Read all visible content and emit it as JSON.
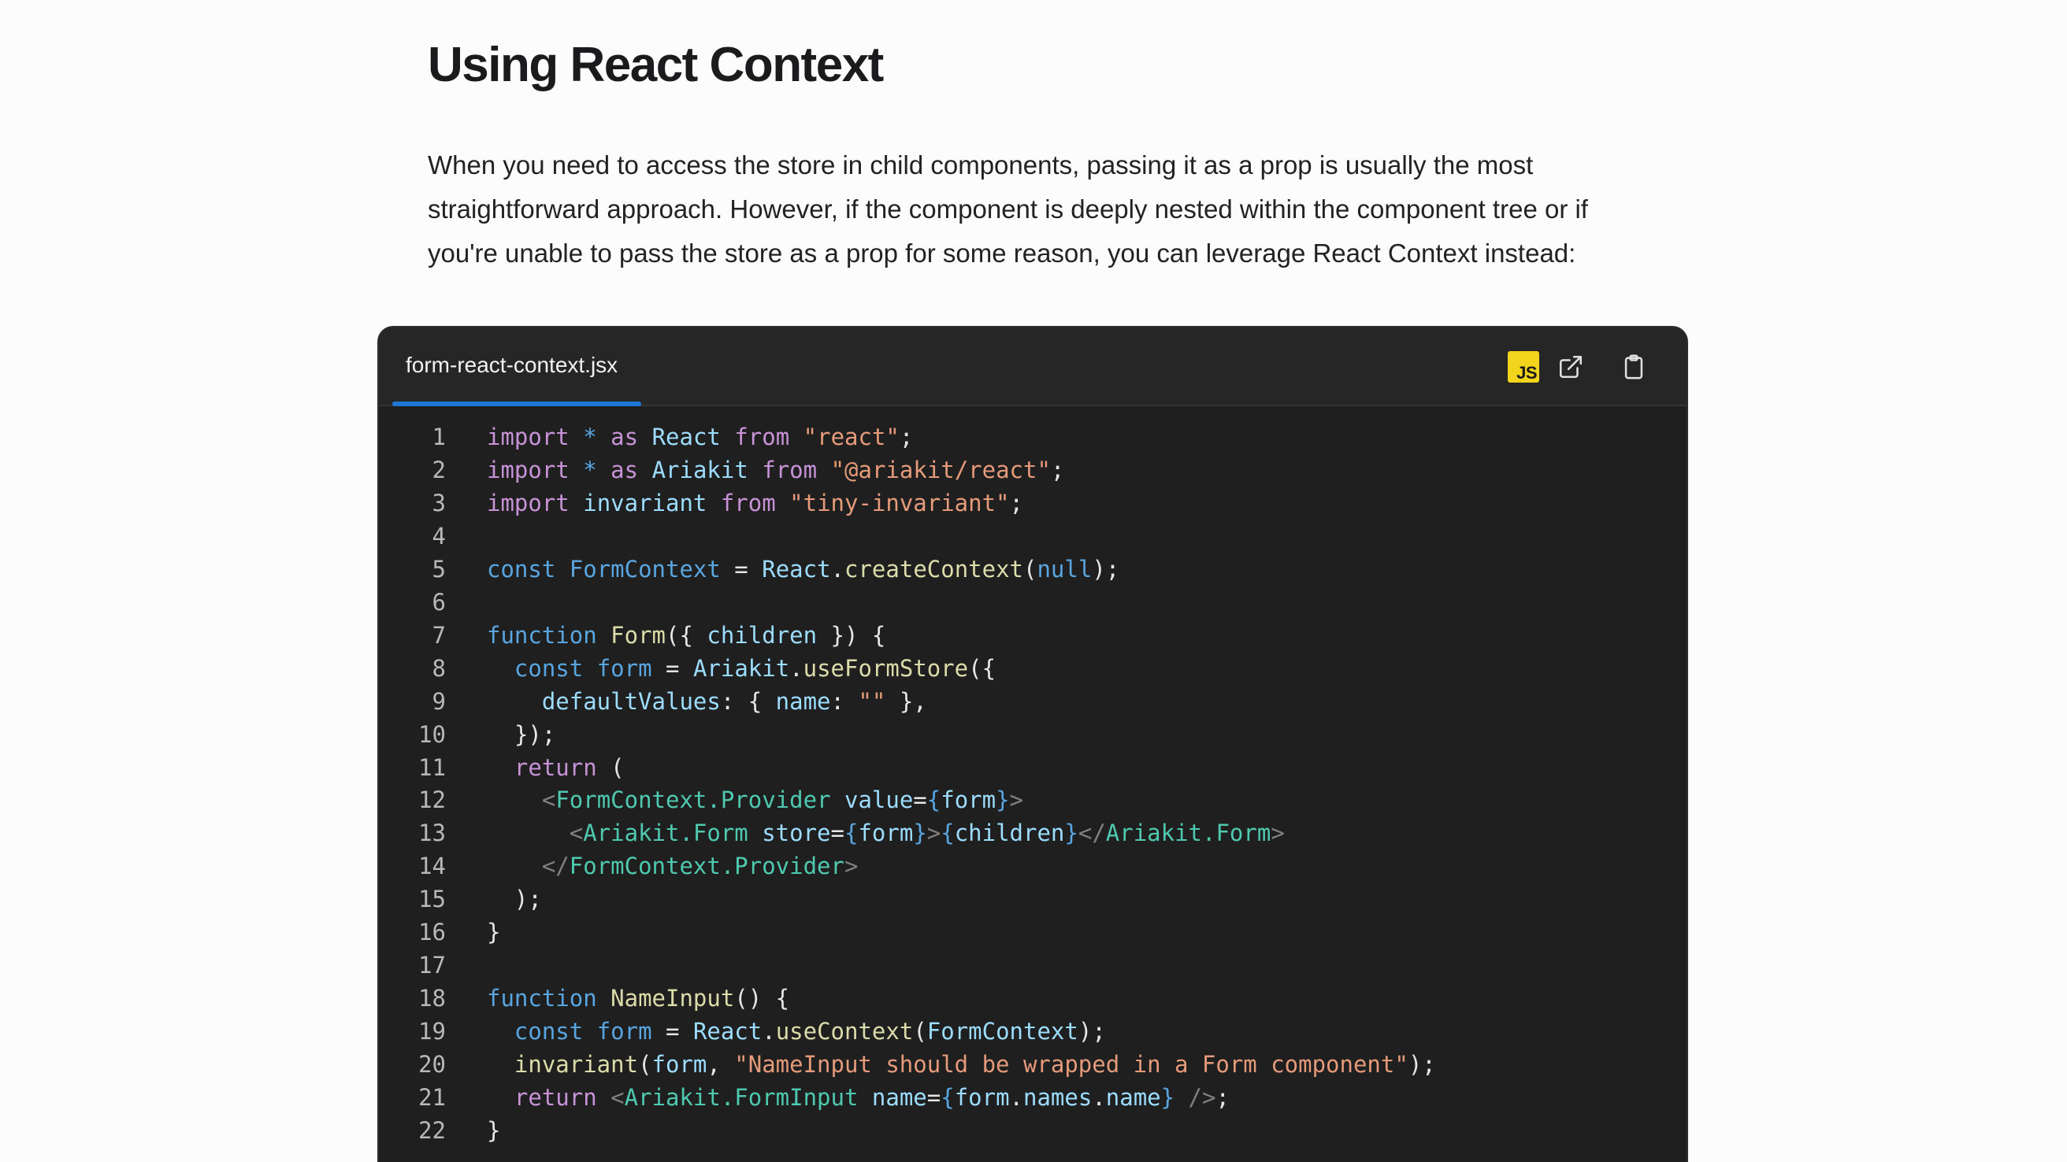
{
  "article": {
    "title": "Using React Context",
    "intro_lines": [
      "When you need to access the store in child components, passing it as a prop is usually the most",
      "straightforward approach. However, if the component is deeply nested within the component tree or if",
      "you're unable to pass the store as a prop for some reason, you can leverage React Context instead:"
    ]
  },
  "code_block": {
    "filename": "form-react-context.jsx",
    "language_badge": "JS",
    "icons": {
      "badge": "javascript-icon",
      "open": "external-link-icon",
      "copy": "clipboard-icon"
    },
    "colors": {
      "keyword": "#c792d6",
      "storage": "#58a5e0",
      "identifier": "#9cdcfe",
      "function": "#dcdcaa",
      "string": "#e59a7a",
      "tag": "#4ec9b0",
      "punct": "#808080",
      "plain": "#e6e6e6",
      "brace": "#58a5e0"
    },
    "lines": [
      {
        "n": "1",
        "tokens": [
          [
            "import",
            "keyword"
          ],
          [
            " ",
            "plain"
          ],
          [
            "*",
            "storage"
          ],
          [
            " ",
            "plain"
          ],
          [
            "as",
            "keyword"
          ],
          [
            " ",
            "plain"
          ],
          [
            "React",
            "identifier"
          ],
          [
            " ",
            "plain"
          ],
          [
            "from",
            "keyword"
          ],
          [
            " ",
            "plain"
          ],
          [
            "\"react\"",
            "string"
          ],
          [
            ";",
            "plain"
          ]
        ]
      },
      {
        "n": "2",
        "tokens": [
          [
            "import",
            "keyword"
          ],
          [
            " ",
            "plain"
          ],
          [
            "*",
            "storage"
          ],
          [
            " ",
            "plain"
          ],
          [
            "as",
            "keyword"
          ],
          [
            " ",
            "plain"
          ],
          [
            "Ariakit",
            "identifier"
          ],
          [
            " ",
            "plain"
          ],
          [
            "from",
            "keyword"
          ],
          [
            " ",
            "plain"
          ],
          [
            "\"@ariakit/react\"",
            "string"
          ],
          [
            ";",
            "plain"
          ]
        ]
      },
      {
        "n": "3",
        "tokens": [
          [
            "import",
            "keyword"
          ],
          [
            " ",
            "plain"
          ],
          [
            "invariant",
            "identifier"
          ],
          [
            " ",
            "plain"
          ],
          [
            "from",
            "keyword"
          ],
          [
            " ",
            "plain"
          ],
          [
            "\"tiny-invariant\"",
            "string"
          ],
          [
            ";",
            "plain"
          ]
        ]
      },
      {
        "n": "4",
        "tokens": []
      },
      {
        "n": "5",
        "tokens": [
          [
            "const",
            "storage"
          ],
          [
            " ",
            "plain"
          ],
          [
            "FormContext",
            "storage"
          ],
          [
            " = ",
            "plain"
          ],
          [
            "React",
            "identifier"
          ],
          [
            ".",
            "plain"
          ],
          [
            "createContext",
            "function"
          ],
          [
            "(",
            "plain"
          ],
          [
            "null",
            "storage"
          ],
          [
            ");",
            "plain"
          ]
        ]
      },
      {
        "n": "6",
        "tokens": []
      },
      {
        "n": "7",
        "tokens": [
          [
            "function",
            "storage"
          ],
          [
            " ",
            "plain"
          ],
          [
            "Form",
            "function"
          ],
          [
            "({ ",
            "plain"
          ],
          [
            "children",
            "identifier"
          ],
          [
            " }) {",
            "plain"
          ]
        ]
      },
      {
        "n": "8",
        "tokens": [
          [
            "  ",
            "plain"
          ],
          [
            "const",
            "storage"
          ],
          [
            " ",
            "plain"
          ],
          [
            "form",
            "storage"
          ],
          [
            " = ",
            "plain"
          ],
          [
            "Ariakit",
            "identifier"
          ],
          [
            ".",
            "plain"
          ],
          [
            "useFormStore",
            "function"
          ],
          [
            "({",
            "plain"
          ]
        ]
      },
      {
        "n": "9",
        "tokens": [
          [
            "    ",
            "plain"
          ],
          [
            "defaultValues",
            "identifier"
          ],
          [
            ": { ",
            "plain"
          ],
          [
            "name",
            "identifier"
          ],
          [
            ": ",
            "plain"
          ],
          [
            "\"\"",
            "string"
          ],
          [
            " },",
            "plain"
          ]
        ]
      },
      {
        "n": "10",
        "tokens": [
          [
            "  });",
            "plain"
          ]
        ]
      },
      {
        "n": "11",
        "tokens": [
          [
            "  ",
            "plain"
          ],
          [
            "return",
            "keyword"
          ],
          [
            " (",
            "plain"
          ]
        ]
      },
      {
        "n": "12",
        "tokens": [
          [
            "    ",
            "plain"
          ],
          [
            "<",
            "punct"
          ],
          [
            "FormContext.Provider",
            "tag"
          ],
          [
            " ",
            "plain"
          ],
          [
            "value",
            "identifier"
          ],
          [
            "=",
            "plain"
          ],
          [
            "{",
            "brace"
          ],
          [
            "form",
            "identifier"
          ],
          [
            "}",
            "brace"
          ],
          [
            ">",
            "punct"
          ]
        ]
      },
      {
        "n": "13",
        "tokens": [
          [
            "      ",
            "plain"
          ],
          [
            "<",
            "punct"
          ],
          [
            "Ariakit.Form",
            "tag"
          ],
          [
            " ",
            "plain"
          ],
          [
            "store",
            "identifier"
          ],
          [
            "=",
            "plain"
          ],
          [
            "{",
            "brace"
          ],
          [
            "form",
            "identifier"
          ],
          [
            "}",
            "brace"
          ],
          [
            ">",
            "punct"
          ],
          [
            "{",
            "brace"
          ],
          [
            "children",
            "identifier"
          ],
          [
            "}",
            "brace"
          ],
          [
            "</",
            "punct"
          ],
          [
            "Ariakit.Form",
            "tag"
          ],
          [
            ">",
            "punct"
          ]
        ]
      },
      {
        "n": "14",
        "tokens": [
          [
            "    ",
            "plain"
          ],
          [
            "</",
            "punct"
          ],
          [
            "FormContext.Provider",
            "tag"
          ],
          [
            ">",
            "punct"
          ]
        ]
      },
      {
        "n": "15",
        "tokens": [
          [
            "  );",
            "plain"
          ]
        ]
      },
      {
        "n": "16",
        "tokens": [
          [
            "}",
            "plain"
          ]
        ]
      },
      {
        "n": "17",
        "tokens": []
      },
      {
        "n": "18",
        "tokens": [
          [
            "function",
            "storage"
          ],
          [
            " ",
            "plain"
          ],
          [
            "NameInput",
            "function"
          ],
          [
            "() {",
            "plain"
          ]
        ]
      },
      {
        "n": "19",
        "tokens": [
          [
            "  ",
            "plain"
          ],
          [
            "const",
            "storage"
          ],
          [
            " ",
            "plain"
          ],
          [
            "form",
            "storage"
          ],
          [
            " = ",
            "plain"
          ],
          [
            "React",
            "identifier"
          ],
          [
            ".",
            "plain"
          ],
          [
            "useContext",
            "function"
          ],
          [
            "(",
            "plain"
          ],
          [
            "FormContext",
            "identifier"
          ],
          [
            ");",
            "plain"
          ]
        ]
      },
      {
        "n": "20",
        "tokens": [
          [
            "  ",
            "plain"
          ],
          [
            "invariant",
            "function"
          ],
          [
            "(",
            "plain"
          ],
          [
            "form",
            "identifier"
          ],
          [
            ", ",
            "plain"
          ],
          [
            "\"NameInput should be wrapped in a Form component\"",
            "string"
          ],
          [
            ");",
            "plain"
          ]
        ]
      },
      {
        "n": "21",
        "tokens": [
          [
            "  ",
            "plain"
          ],
          [
            "return",
            "keyword"
          ],
          [
            " ",
            "plain"
          ],
          [
            "<",
            "punct"
          ],
          [
            "Ariakit.FormInput",
            "tag"
          ],
          [
            " ",
            "plain"
          ],
          [
            "name",
            "identifier"
          ],
          [
            "=",
            "plain"
          ],
          [
            "{",
            "brace"
          ],
          [
            "form",
            "identifier"
          ],
          [
            ".",
            "plain"
          ],
          [
            "names",
            "identifier"
          ],
          [
            ".",
            "plain"
          ],
          [
            "name",
            "identifier"
          ],
          [
            "}",
            "brace"
          ],
          [
            " />",
            "punct"
          ],
          [
            ";",
            "plain"
          ]
        ]
      },
      {
        "n": "22",
        "tokens": [
          [
            "}",
            "plain"
          ]
        ]
      }
    ]
  }
}
